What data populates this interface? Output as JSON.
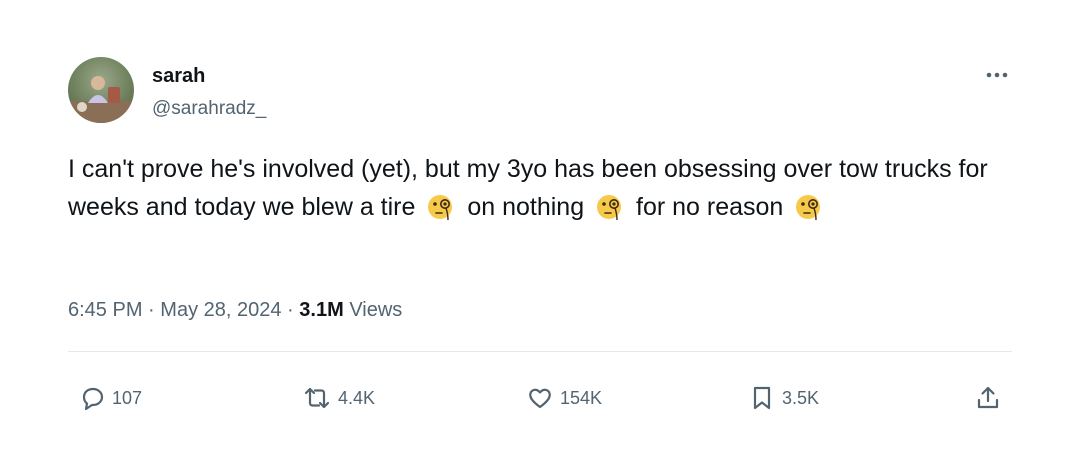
{
  "user": {
    "display_name": "sarah",
    "handle": "@sarahradz_",
    "avatar_icon": "profile-photo"
  },
  "tweet": {
    "text_segments": [
      "I can't prove he's involved (yet), but my 3yo has been obsessing over tow trucks for weeks and today we blew a tire",
      "on nothing",
      "for no reason"
    ],
    "emoji_icon": "face-with-monocle-icon"
  },
  "meta": {
    "time": "6:45 PM",
    "separator": "·",
    "date": "May 28, 2024",
    "views_count": "3.1M",
    "views_label": "Views"
  },
  "actions": {
    "replies": "107",
    "reposts": "4.4K",
    "likes": "154K",
    "bookmarks": "3.5K"
  },
  "colors": {
    "text": "#0f1419",
    "secondary": "#536471",
    "divider": "#e6e9ec",
    "emoji": "#f7c948"
  }
}
